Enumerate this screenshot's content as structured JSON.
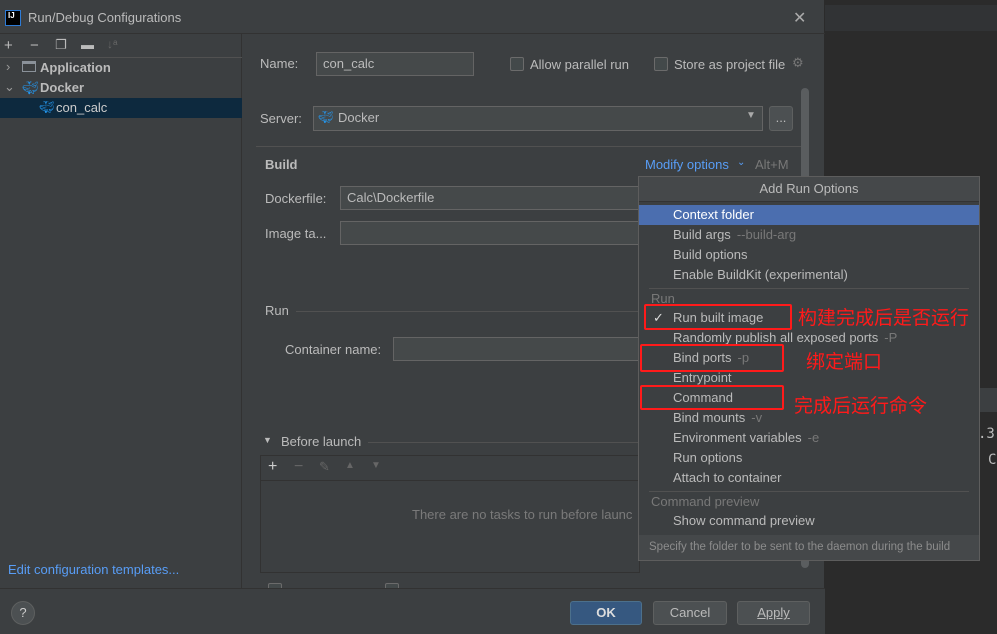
{
  "window": {
    "title": "Run/Debug Configurations",
    "close_icon": "close-icon"
  },
  "background": {
    "text1": ".3",
    "text2": "C"
  },
  "sidebar": {
    "toolbar": [
      "add-icon",
      "remove-icon",
      "copy-icon",
      "new-folder-icon",
      "sort-icon"
    ],
    "tree": [
      {
        "label": "Application",
        "expanded": false
      },
      {
        "label": "Docker",
        "expanded": true,
        "children": [
          {
            "label": "con_calc",
            "selected": true
          }
        ]
      }
    ],
    "edit_templates": "Edit configuration templates..."
  },
  "form": {
    "name_label": "Name:",
    "name_value": "con_calc",
    "allow_parallel": "Allow parallel run",
    "store_project": "Store as project file",
    "server_label": "Server:",
    "server_value": "Docker",
    "server_more": "...",
    "build_header": "Build",
    "modify_options": "Modify options",
    "modify_shortcut": "Alt+M",
    "dockerfile_label": "Dockerfile:",
    "dockerfile_value": "Calc\\Dockerfile",
    "image_tag_label": "Image ta...",
    "run_header": "Run",
    "container_label": "Container name:",
    "before_launch": "Before launch",
    "no_tasks": "There are no tasks to run before launc"
  },
  "buttons": {
    "ok": "OK",
    "cancel": "Cancel",
    "apply": "Apply",
    "help": "?"
  },
  "popup": {
    "title": "Add Run Options",
    "build_items": [
      {
        "label": "Context folder",
        "hint": "",
        "active": true
      },
      {
        "label": "Build args",
        "hint": "--build-arg"
      },
      {
        "label": "Build options",
        "hint": ""
      },
      {
        "label": "Enable BuildKit (experimental)",
        "hint": ""
      }
    ],
    "run_group": "Run",
    "run_items": [
      {
        "label": "Run built image",
        "hint": "",
        "checked": true
      },
      {
        "label": "Randomly publish all exposed ports",
        "hint": "-P"
      },
      {
        "label": "Bind ports",
        "hint": "-p"
      },
      {
        "label": "Entrypoint",
        "hint": ""
      },
      {
        "label": "Command",
        "hint": ""
      },
      {
        "label": "Bind mounts",
        "hint": "-v"
      },
      {
        "label": "Environment variables",
        "hint": "-e"
      },
      {
        "label": "Run options",
        "hint": ""
      },
      {
        "label": "Attach to container",
        "hint": ""
      }
    ],
    "preview_group": "Command preview",
    "preview_items": [
      {
        "label": "Show command preview",
        "hint": ""
      }
    ],
    "footer": "Specify the folder to be sent to the daemon during the build"
  },
  "annotations": {
    "run_built_image": "构建完成后是否运行",
    "bind_ports": "绑定端口",
    "command": "完成后运行命令",
    "color": "#ff1a1a"
  }
}
